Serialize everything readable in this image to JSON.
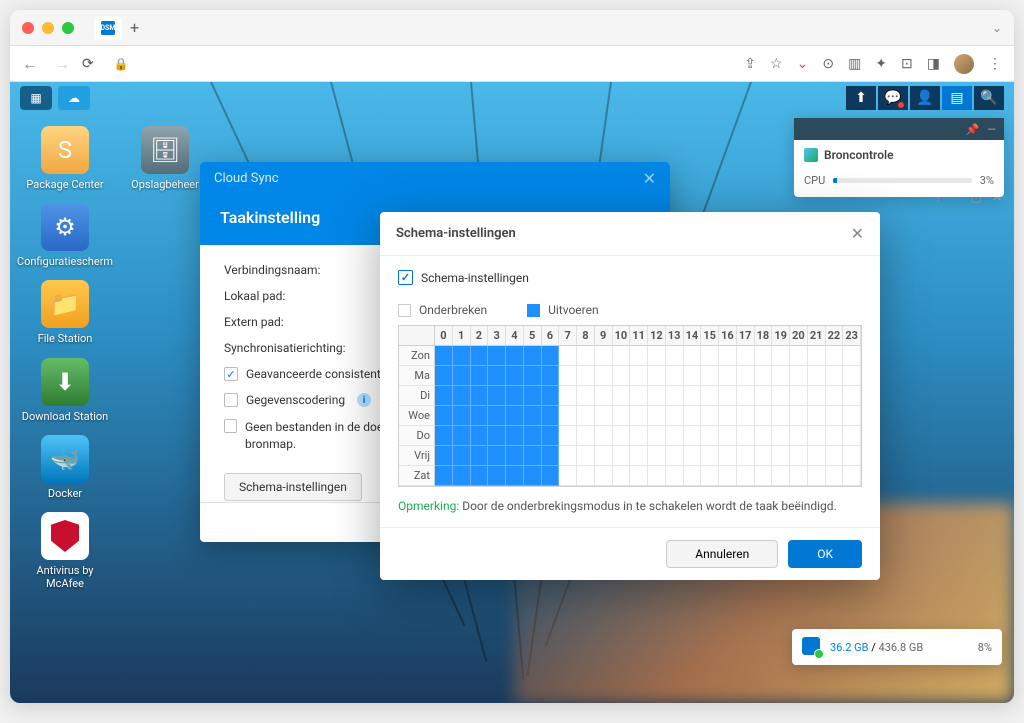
{
  "browser": {
    "tab_favicon": "DSM",
    "new_tab": "+"
  },
  "dsm": {
    "desktop_icons": [
      {
        "name": "package-center",
        "label": "Package Center",
        "cls": "ic-package",
        "glyph": "S"
      },
      {
        "name": "config-panel",
        "label": "Configuratiescherm",
        "cls": "ic-config",
        "glyph": "⚙"
      },
      {
        "name": "file-station",
        "label": "File Station",
        "cls": "ic-file",
        "glyph": "📁"
      },
      {
        "name": "download-station",
        "label": "Download Station",
        "cls": "ic-download",
        "glyph": "⬇"
      },
      {
        "name": "docker",
        "label": "Docker",
        "cls": "ic-docker",
        "glyph": "🐳"
      },
      {
        "name": "antivirus",
        "label": "Antivirus by McAfee",
        "cls": "ic-mcafee",
        "glyph": ""
      }
    ],
    "desktop_icons_col2": [
      {
        "name": "storage-manager",
        "label": "Opslagbeheer",
        "cls": "",
        "glyph": "🗄"
      }
    ]
  },
  "cloudsync": {
    "title": "Cloud Sync",
    "header": "Taakinstelling",
    "label_connection": "Verbindingsnaam:",
    "label_local": "Lokaal pad:",
    "label_remote": "Extern pad:",
    "label_direction": "Synchronisatierichting:",
    "cb_advanced": "Geavanceerde consistentiecontrole",
    "cb_encrypt": "Gegevenscodering",
    "cb_nodelete": "Geen bestanden in de doelmap verwijderen als deze zijn verwijderd in de bronmap.",
    "btn_schedule": "Schema-instellingen"
  },
  "schedule": {
    "title": "Schema-instellingen",
    "cb_enable": "Schema-instellingen",
    "legend_pause": "Onderbreken",
    "legend_run": "Uitvoeren",
    "hours": [
      "0",
      "1",
      "2",
      "3",
      "4",
      "5",
      "6",
      "7",
      "8",
      "9",
      "10",
      "11",
      "12",
      "13",
      "14",
      "15",
      "16",
      "17",
      "18",
      "19",
      "20",
      "21",
      "22",
      "23"
    ],
    "days": [
      "Zon",
      "Ma",
      "Di",
      "Woe",
      "Do",
      "Vrij",
      "Zat"
    ],
    "on_columns": [
      0,
      1,
      2,
      3,
      4,
      5,
      6
    ],
    "note_label": "Opmerking:",
    "note_text": "Door de onderbrekingsmodus in te schakelen wordt de taak beëindigd.",
    "btn_cancel": "Annuleren",
    "btn_ok": "OK"
  },
  "resource": {
    "title": "Broncontrole",
    "cpu_label": "CPU",
    "cpu_pct": "3%"
  },
  "storage": {
    "used": "36.2 GB",
    "sep": " / ",
    "total": "436.8 GB",
    "pct": "8%"
  }
}
